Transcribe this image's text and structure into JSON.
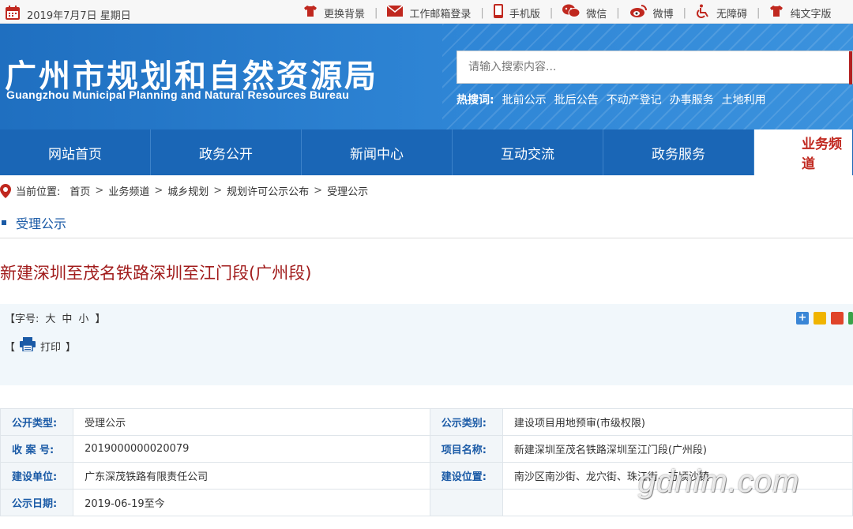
{
  "topbar": {
    "date": "2019年7月7日 星期日",
    "links": [
      "更换背景",
      "工作邮箱登录",
      "手机版",
      "微信",
      "微博",
      "无障碍",
      "纯文字版"
    ]
  },
  "header": {
    "title_cn": "广州市规划和自然资源局",
    "title_en": "Guangzhou Municipal Planning and Natural Resources Bureau",
    "search_placeholder": "请输入搜索内容...",
    "hot_label": "热搜词:",
    "hot_words": [
      "批前公示",
      "批后公告",
      "不动产登记",
      "办事服务",
      "土地利用"
    ]
  },
  "nav": [
    "网站首页",
    "政务公开",
    "新闻中心",
    "互动交流",
    "政务服务",
    "业务频道"
  ],
  "breadcrumb": {
    "label": "当前位置:",
    "items": [
      "首页",
      "业务频道",
      "城乡规划",
      "规划许可公示公布",
      "受理公示"
    ]
  },
  "section_title": "受理公示",
  "article_title": "新建深圳至茂名铁路深圳至江门段(广州段)",
  "tools": {
    "font_label": "【字号:",
    "font_sizes": [
      "大",
      "中",
      "小"
    ],
    "font_end": "】",
    "print_open": "【",
    "print_label": "打印",
    "print_close": "】"
  },
  "info_rows": [
    {
      "l1": "公开类型:",
      "v1": "受理公示",
      "l2": "公示类别:",
      "v2": "建设项目用地预审(市级权限)"
    },
    {
      "l1": "收 案 号:",
      "v1": "2019000000020079",
      "l2": "项目名称:",
      "v2": "新建深圳至茂名铁路深圳至江门段(广州段)"
    },
    {
      "l1": "建设单位:",
      "v1": "广东深茂铁路有限责任公司",
      "l2": "建设位置:",
      "v2": "南沙区南沙街、龙穴街、珠江街、万顷沙镇"
    },
    {
      "l1": "公示日期:",
      "v1": "2019-06-19至今",
      "l2": "",
      "v2": ""
    }
  ],
  "watermark": "gdnim.com",
  "colors": {
    "brand_blue": "#1a66b6",
    "accent_red": "#c0281f",
    "title_red": "#a11c1c"
  }
}
